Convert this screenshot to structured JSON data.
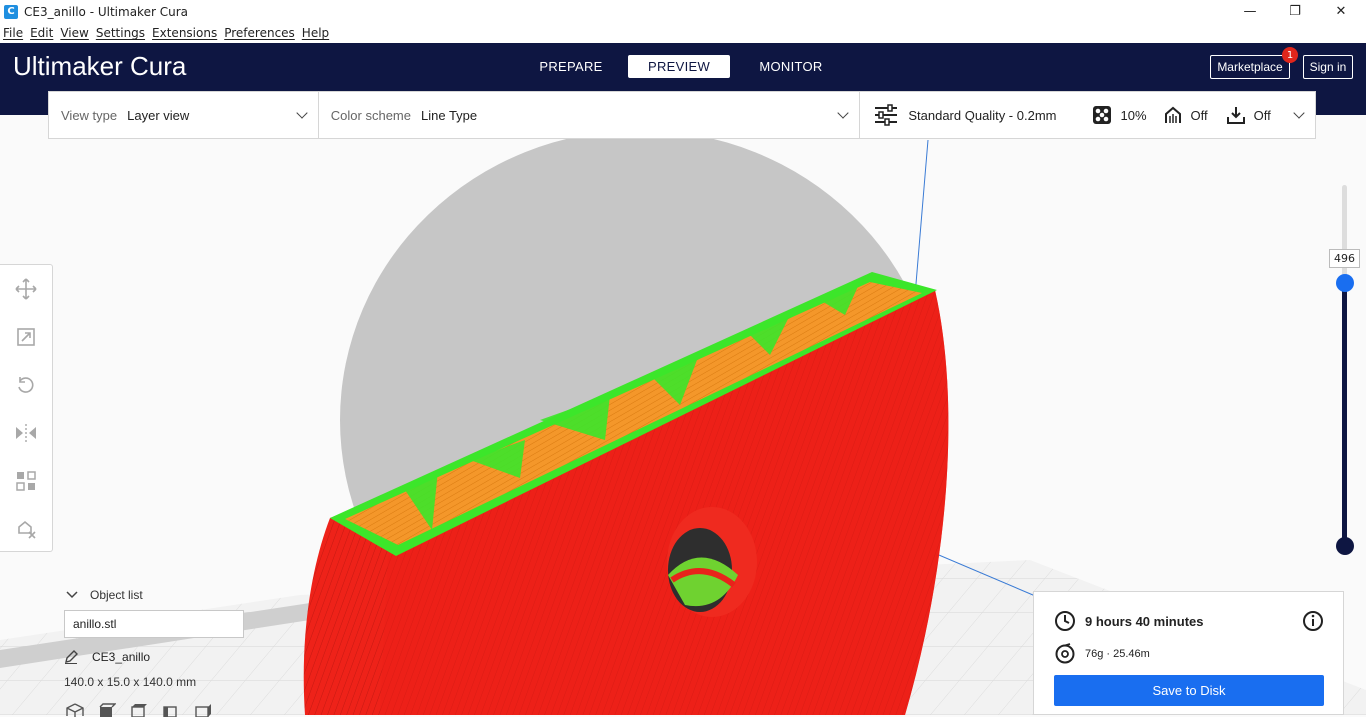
{
  "window": {
    "title": "CE3_anillo - Ultimaker Cura",
    "app_icon": "C",
    "minimize": "—",
    "maximize": "❐",
    "close": "✕"
  },
  "menu": [
    "File",
    "Edit",
    "View",
    "Settings",
    "Extensions",
    "Preferences",
    "Help"
  ],
  "header": {
    "brand_bold": "Ultimaker",
    "brand_light": "Cura",
    "tabs": [
      "PREPARE",
      "PREVIEW",
      "MONITOR"
    ],
    "active_tab": "PREVIEW",
    "marketplace": "Marketplace",
    "marketplace_badge": "1",
    "sign_in": "Sign in"
  },
  "toolbar": {
    "view_type_label": "View type",
    "view_type_value": "Layer view",
    "color_scheme_label": "Color scheme",
    "color_scheme_value": "Line Type",
    "quality": "Standard Quality - 0.2mm",
    "infill": "10%",
    "support": "Off",
    "adhesion": "Off"
  },
  "layer_slider": {
    "current_layer": "496",
    "level_fraction": 1.0
  },
  "object_list": {
    "header": "Object list",
    "selected_file": "anillo.stl",
    "object_name": "CE3_anillo",
    "dimensions": "140.0 x 15.0 x 140.0 mm"
  },
  "print_info": {
    "time": "9 hours 40 minutes",
    "material": "76g · 25.46m",
    "save_button": "Save to Disk"
  },
  "colors": {
    "header_bg": "#0e1642",
    "accent": "#196ef0",
    "wall_outer": "#e8231b",
    "wall_inner": "#3ce62a",
    "infill": "#f4972a",
    "shadow": "#c8c8c8"
  }
}
